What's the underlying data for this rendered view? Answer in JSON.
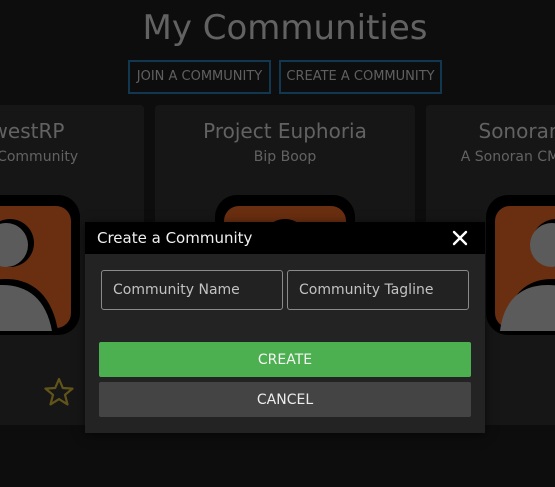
{
  "page": {
    "title": "My Communities"
  },
  "actions": {
    "join_label": "JOIN A COMMUNITY",
    "create_label": "CREATE A COMMUNITY"
  },
  "communities": [
    {
      "name": "westRP",
      "tagline": "CMS Community"
    },
    {
      "name": "Project Euphoria",
      "tagline": "Bip Boop"
    },
    {
      "name": "Sonoran",
      "tagline": "A Sonoran CMS To"
    }
  ],
  "modal": {
    "title": "Create a Community",
    "name_placeholder": "Community Name",
    "tagline_placeholder": "Community Tagline",
    "create_label": "CREATE",
    "cancel_label": "CANCEL"
  },
  "colors": {
    "accent_green": "#4caf50",
    "button_border_blue": "#1f5f8c",
    "avatar_orange": "#b7501c",
    "star_gold": "#a8912d"
  },
  "icons": {
    "favorite": "star-icon",
    "close": "close-icon",
    "avatar": "default-user-avatar-icon"
  }
}
